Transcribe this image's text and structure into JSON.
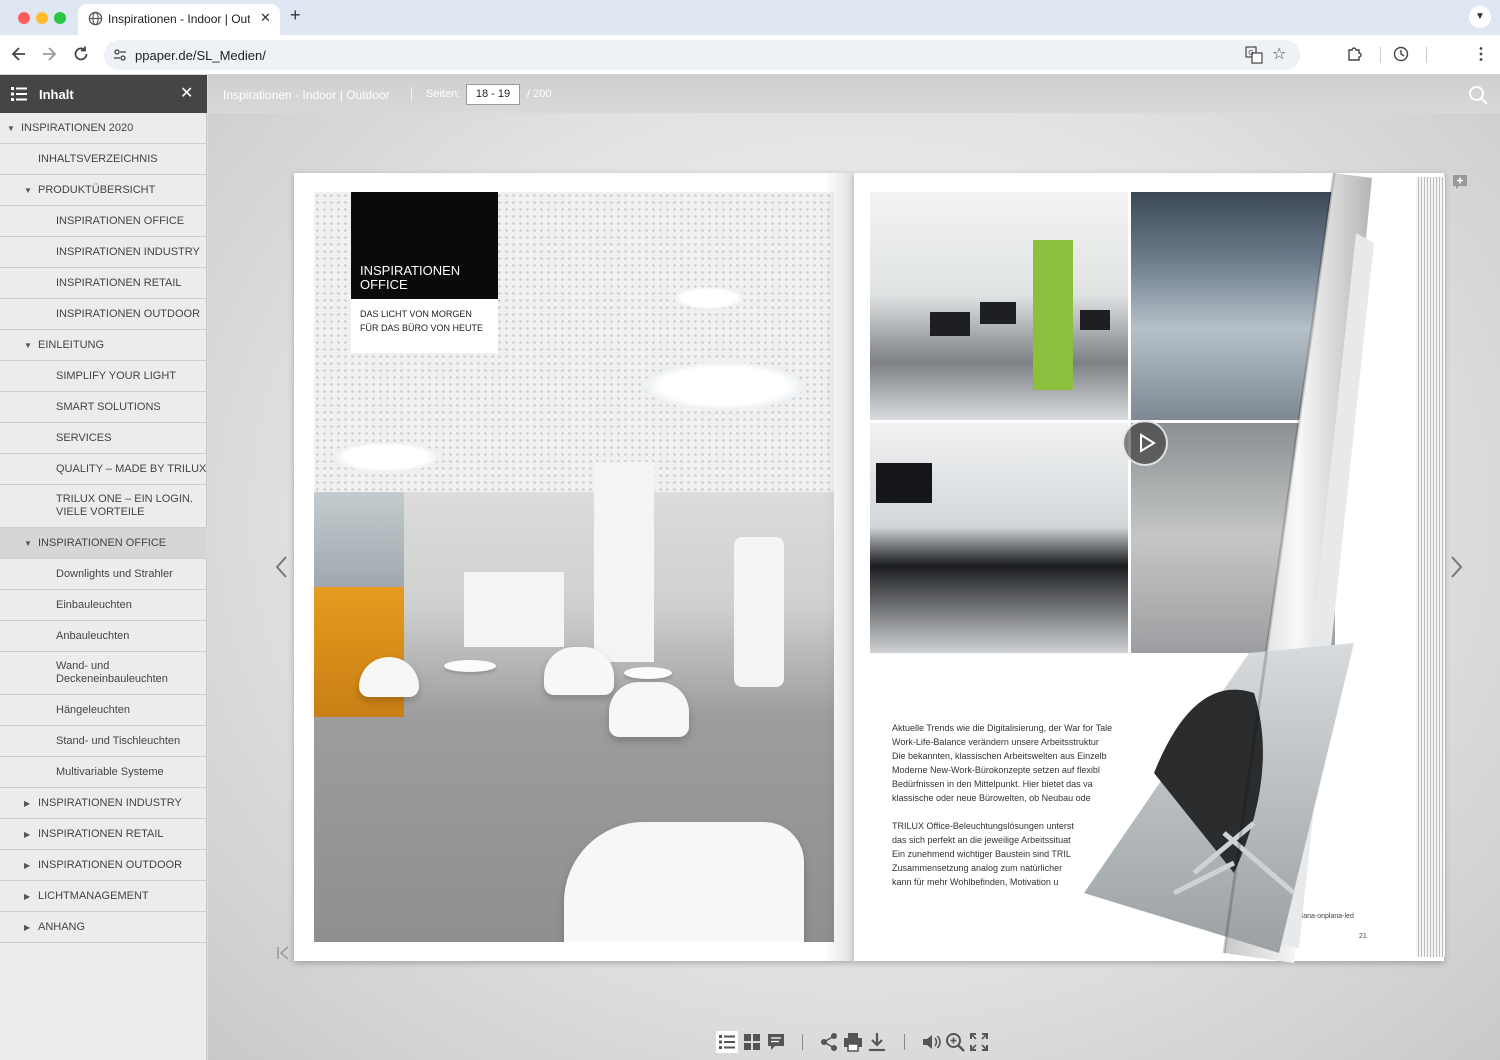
{
  "browser": {
    "tab_title": "Inspirationen - Indoor | Outdoor",
    "tab_close": "✕",
    "new_tab": "+",
    "url": "ppaper.de/SL_Medien/",
    "icons": [
      "globe-icon",
      "back-icon",
      "forward-icon",
      "reload-icon",
      "site-info-icon",
      "translate-icon",
      "star-icon",
      "extensions-icon",
      "history-icon",
      "more-icon",
      "tab-list-icon"
    ]
  },
  "sidebar": {
    "title": "Inhalt",
    "close": "✕",
    "items": [
      {
        "label": "INSPIRATIONEN 2020",
        "level": 0,
        "arrow": "▼"
      },
      {
        "label": "INHALTSVERZEICHNIS",
        "level": 1,
        "arrow": ""
      },
      {
        "label": "PRODUKTÜBERSICHT",
        "level": 1,
        "arrow": "▼"
      },
      {
        "label": "INSPIRATIONEN OFFICE",
        "level": 2,
        "arrow": ""
      },
      {
        "label": "INSPIRATIONEN INDUSTRY",
        "level": 2,
        "arrow": ""
      },
      {
        "label": "INSPIRATIONEN RETAIL",
        "level": 2,
        "arrow": ""
      },
      {
        "label": "INSPIRATIONEN OUTDOOR",
        "level": 2,
        "arrow": ""
      },
      {
        "label": "EINLEITUNG",
        "level": 1,
        "arrow": "▼"
      },
      {
        "label": "SIMPLIFY YOUR LIGHT",
        "level": 2,
        "arrow": ""
      },
      {
        "label": "SMART SOLUTIONS",
        "level": 2,
        "arrow": ""
      },
      {
        "label": "SERVICES",
        "level": 2,
        "arrow": ""
      },
      {
        "label": "QUALITY – MADE BY TRILUX",
        "level": 2,
        "arrow": ""
      },
      {
        "label": "TRILUX ONE – EIN LOGIN.\nVIELE VORTEILE",
        "level": 2,
        "arrow": ""
      },
      {
        "label": "INSPIRATIONEN OFFICE",
        "level": 1,
        "arrow": "▼",
        "active": true
      },
      {
        "label": "Downlights und Strahler",
        "level": 2,
        "arrow": ""
      },
      {
        "label": "Einbauleuchten",
        "level": 2,
        "arrow": ""
      },
      {
        "label": "Anbauleuchten",
        "level": 2,
        "arrow": ""
      },
      {
        "label": "Wand- und\nDeckeneinbauleuchten",
        "level": 2,
        "arrow": ""
      },
      {
        "label": "Hängeleuchten",
        "level": 2,
        "arrow": ""
      },
      {
        "label": "Stand- und Tischleuchten",
        "level": 2,
        "arrow": ""
      },
      {
        "label": "Multivariable Systeme",
        "level": 2,
        "arrow": ""
      },
      {
        "label": "INSPIRATIONEN INDUSTRY",
        "level": 1,
        "arrow": "▶"
      },
      {
        "label": "INSPIRATIONEN RETAIL",
        "level": 1,
        "arrow": "▶"
      },
      {
        "label": "INSPIRATIONEN OUTDOOR",
        "level": 1,
        "arrow": "▶"
      },
      {
        "label": "LICHTMANAGEMENT",
        "level": 1,
        "arrow": "▶"
      },
      {
        "label": "ANHANG",
        "level": 1,
        "arrow": "▶"
      }
    ]
  },
  "viewer": {
    "doc_title": "Inspirationen - Indoor | Outdoor",
    "pages_label": "Seiten:",
    "pages_value": "18 - 19",
    "pages_total": "/   200"
  },
  "spread": {
    "left_title": "INSPIRATIONEN\nOFFICE",
    "left_subtitle": "DAS LICHT VON MORGEN\nFÜR DAS BÜRO VON HEUTE",
    "body_1": "Aktuelle Trends wie die Digitalisierung, der War for Tale\nWork-Life-Balance verändern unsere Arbeitsstruktur\nDie bekannten, klassischen Arbeitswelten aus Einzelb\nModerne New-Work-Bürokonzepte setzen auf flexibl\nBedürfnissen in den Mittelpunkt. Hier bietet das va\nklassische oder neue Bürowelten, ob Neubau ode",
    "body_2": "TRILUX Office-Beleuchtungslösungen unterst\ndas sich perfekt an die jeweilige Arbeitssituat\nEin zunehmend wichtiger Baustein sind TRIL\nZusammensetzung analog zum natürlicher\nkann für mehr Wohlbefinden, Motivation u",
    "url_small": "he www.trilux.com/inplana-onplana-led",
    "page_number": "21"
  },
  "bottom_toolbar": {
    "icons": [
      "toc-icon",
      "thumbnails-icon",
      "notes-icon",
      "share-icon",
      "print-icon",
      "download-icon",
      "sound-icon",
      "zoom-icon",
      "fullscreen-icon"
    ],
    "active": "toc-icon"
  }
}
